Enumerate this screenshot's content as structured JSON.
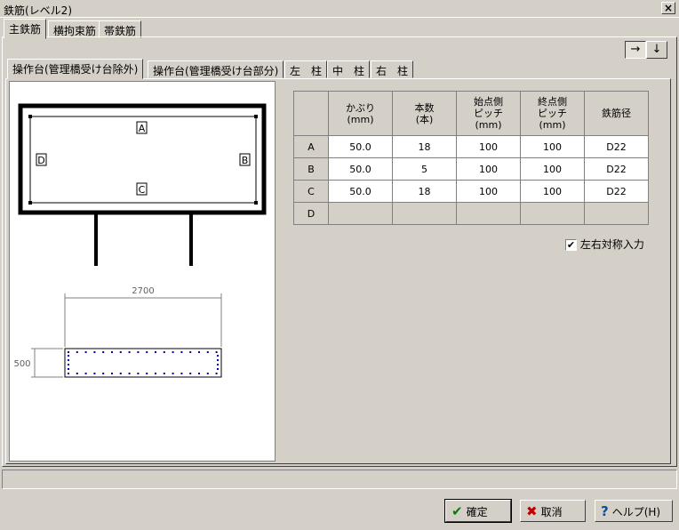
{
  "window": {
    "title": "鉄筋(レベル2)",
    "close_label": "×"
  },
  "top_tabs": [
    "主鉄筋",
    "横拘束筋",
    "帯鉄筋"
  ],
  "arrow_buttons": [
    "→",
    "↓"
  ],
  "sub_tabs": [
    "操作台(管理橋受け台除外)",
    "操作台(管理橋受け台部分)",
    "左　柱",
    "中　柱",
    "右　柱"
  ],
  "diagram": {
    "labels": [
      "A",
      "B",
      "C",
      "D"
    ],
    "dim_width": "2700",
    "dim_height": "500"
  },
  "table": {
    "headers": [
      "かぶり\n(mm)",
      "本数\n(本)",
      "始点側\nピッチ\n(mm)",
      "終点側\nピッチ\n(mm)",
      "鉄筋径"
    ],
    "rows": [
      {
        "label": "A",
        "values": [
          "50.0",
          "18",
          "100",
          "100",
          "D22"
        ]
      },
      {
        "label": "B",
        "values": [
          "50.0",
          "5",
          "100",
          "100",
          "D22"
        ]
      },
      {
        "label": "C",
        "values": [
          "50.0",
          "18",
          "100",
          "100",
          "D22"
        ]
      },
      {
        "label": "D",
        "values": [
          "",
          "",
          "",
          "",
          ""
        ]
      }
    ]
  },
  "symmetric_checkbox": {
    "label": "左右対称入力",
    "checked": true
  },
  "buttons": {
    "ok": {
      "label": "確定",
      "icon": "check-icon"
    },
    "cancel": {
      "label": "取消",
      "icon": "x-icon"
    },
    "help": {
      "label": "ヘルプ(H)",
      "icon": "question-icon"
    }
  }
}
